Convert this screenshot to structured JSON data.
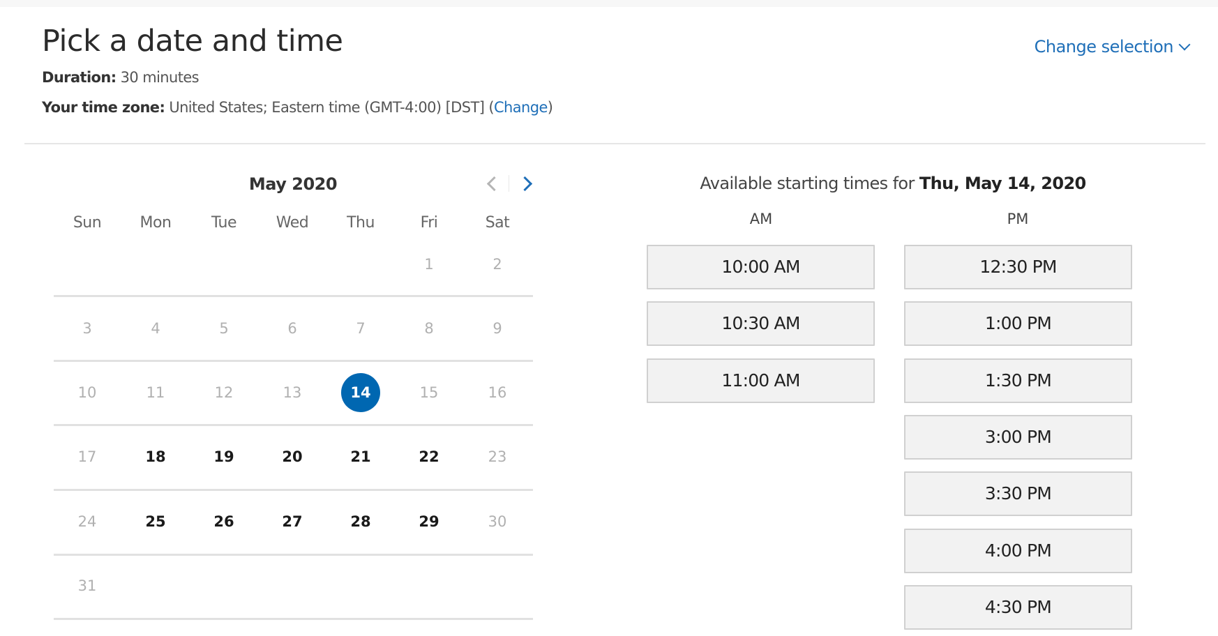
{
  "header": {
    "title": "Pick a date and time",
    "duration_label": "Duration:",
    "duration_value": "30 minutes",
    "timezone_label": "Your time zone:",
    "timezone_value": "United States;  Eastern time  (GMT-4:00) [DST]",
    "timezone_change_open": "(",
    "timezone_change_link": "Change",
    "timezone_change_close": ")",
    "change_selection": "Change selection",
    "change_selection_icon": "chevron-down-icon"
  },
  "calendar": {
    "month_label": "May 2020",
    "prev_icon": "chevron-left-icon",
    "next_icon": "chevron-right-icon",
    "weekdays": [
      "Sun",
      "Mon",
      "Tue",
      "Wed",
      "Thu",
      "Fri",
      "Sat"
    ],
    "selected_day": 14,
    "available_days": [
      18,
      19,
      20,
      21,
      22,
      25,
      26,
      27,
      28,
      29
    ],
    "first_weekday_index": 5,
    "days_in_month": 31,
    "accent_color": "#0067b1"
  },
  "times": {
    "header_prefix": "Available starting times for",
    "header_date": "Thu, May 14, 2020",
    "am_label": "AM",
    "pm_label": "PM",
    "am_slots": [
      "10:00 AM",
      "10:30 AM",
      "11:00 AM"
    ],
    "pm_slots": [
      "12:30 PM",
      "1:00 PM",
      "1:30 PM",
      "3:00 PM",
      "3:30 PM",
      "4:00 PM",
      "4:30 PM"
    ]
  }
}
